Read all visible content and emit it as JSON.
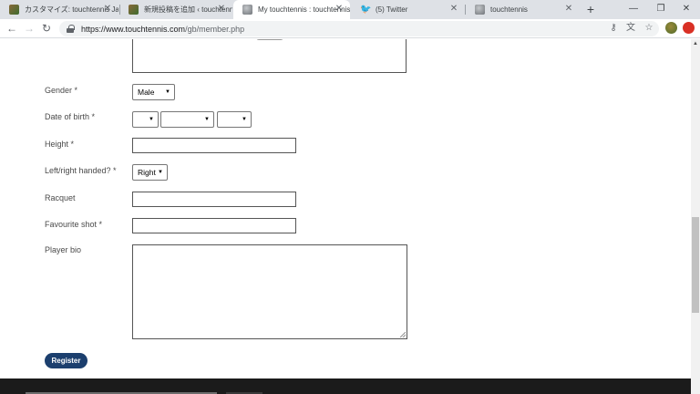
{
  "browser": {
    "tabs": [
      {
        "title": "カスタマイズ: touchtennis Japan",
        "favicon": "image-favicon",
        "active": false
      },
      {
        "title": "新規投稿を追加 ‹ touchtennis",
        "favicon": "image-favicon",
        "active": false
      },
      {
        "title": "My touchtennis : touchtennis",
        "favicon": "globe-favicon",
        "active": true
      },
      {
        "title": "(5) Twitter",
        "favicon": "twitter-favicon",
        "active": false
      },
      {
        "title": "touchtennis",
        "favicon": "globe-favicon",
        "active": false
      }
    ],
    "close_glyph": "✕",
    "new_tab_glyph": "+",
    "window_controls": {
      "minimize": "—",
      "maximize": "❐",
      "close": "✕"
    },
    "nav": {
      "back": "←",
      "forward": "→",
      "reload": "↻"
    },
    "url": {
      "host": "https://www.touchtennis.com",
      "path": "/gb/member.php"
    },
    "omnibox_icons": {
      "key": "⚷",
      "translate": "⽂",
      "star": "☆"
    },
    "menu_glyph": "⋮",
    "accent_colors": {
      "register_button": "#1c3f6e",
      "twitter": "#1da1f2",
      "extension_red": "#d93025"
    }
  },
  "form": {
    "gender": {
      "label": "Gender *",
      "value": "Male"
    },
    "dob": {
      "label": "Date of birth *",
      "day": "",
      "month": "",
      "year": ""
    },
    "height": {
      "label": "Height *",
      "value": ""
    },
    "handed": {
      "label": "Left/right handed? *",
      "value": "Right"
    },
    "racquet": {
      "label": "Racquet",
      "value": ""
    },
    "shot": {
      "label": "Favourite shot *",
      "value": ""
    },
    "bio": {
      "label": "Player bio",
      "value": ""
    },
    "register_label": "Register"
  },
  "scroll_up_glyph": "▲",
  "caret": "▼"
}
